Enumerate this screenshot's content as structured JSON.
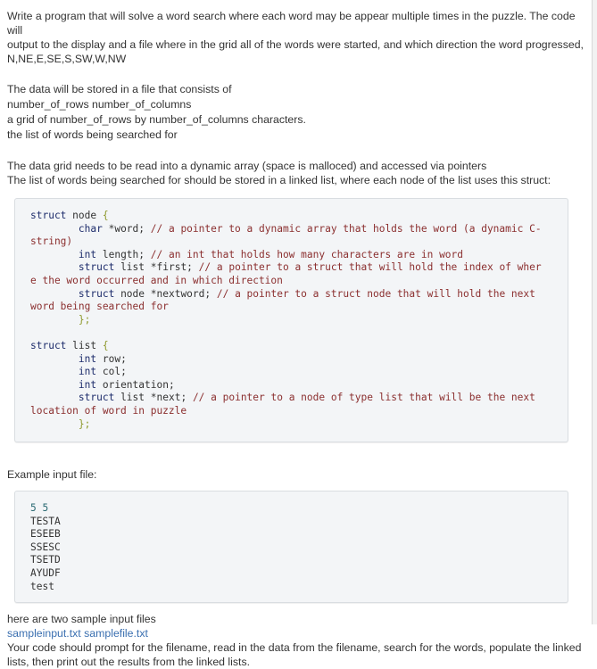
{
  "intro": "Write a program that will solve a word search where each word may be appear multiple times in the puzzle. The code will output to the display and a file where in the grid all of the words were started, and which direction the word progressed, N,NE,E,SE,S,SW,W,NW",
  "intro_lines": [
    "Write a program that will solve a word search where each word may be appear multiple times in the puzzle. The code will",
    "output to the display and a file where in the grid all of the words were started, and which direction the word progressed,",
    "N,NE,E,SE,S,SW,W,NW"
  ],
  "data_description": [
    "The data will be stored in a file that consists of",
    "number_of_rows number_of_columns",
    "a grid of number_of_rows by number_of_columns characters.",
    "the list of words being searched for"
  ],
  "requirements": [
    "The data grid needs to be read into a dynamic array (space is malloced) and accessed via pointers",
    "The list of words being searched for should be stored in a linked list, where each node of the list uses this struct:"
  ],
  "code": {
    "struct_node_header": [
      "struct",
      "node",
      "{"
    ],
    "node_fields": [
      {
        "type": "char",
        "name": "*word;",
        "comment": "// a pointer to a dynamic array that holds the word (a dynamic C-",
        "wrap": "string)"
      },
      {
        "type": "int",
        "name": "length;",
        "comment": "// an int that holds how many characters are in word",
        "wrap": ""
      },
      {
        "type": "struct list",
        "name": "*first;",
        "comment": "// a pointer to a struct that will hold the index of wher",
        "wrap": "e the word occurred and in which direction"
      },
      {
        "type": "struct node",
        "name": "*nextword;",
        "comment": "// a pointer to a struct node that will hold the next",
        "wrap": "word being searched for"
      }
    ],
    "struct_close": "};",
    "struct_list_header": [
      "struct",
      "list",
      "{"
    ],
    "list_fields": [
      {
        "type": "int",
        "name": "row;",
        "comment": "",
        "wrap": ""
      },
      {
        "type": "int",
        "name": "col;",
        "comment": "",
        "wrap": ""
      },
      {
        "type": "int",
        "name": "orientation;",
        "comment": "",
        "wrap": ""
      },
      {
        "type": "struct list",
        "name": "*next;",
        "comment": "// a pointer to a node of type list that will be the next",
        "wrap": "location of word in puzzle"
      }
    ]
  },
  "example_label": "Example input file:",
  "example_input": {
    "dimensions": "5 5",
    "grid": [
      "TESTA",
      "ESEEB",
      "SSESC",
      "TSETD",
      "AYUDF"
    ],
    "words": [
      "test"
    ]
  },
  "samples_text": "here are two sample input files",
  "sample_links": [
    "sampleinput.txt",
    "samplefile.txt"
  ],
  "closing": [
    "Your code should prompt for the filename, read in the data from the filename, search for the words, populate the linked",
    "lists, then print out the results from the linked lists."
  ],
  "colors": {
    "text": "#333333",
    "link": "#3a6fb0",
    "code_bg": "#f3f5f7",
    "code_keyword": "#1d2c6b",
    "code_comment": "#8b2f2f",
    "code_brace": "#8f9a2f",
    "code_number": "#2b6a73"
  }
}
